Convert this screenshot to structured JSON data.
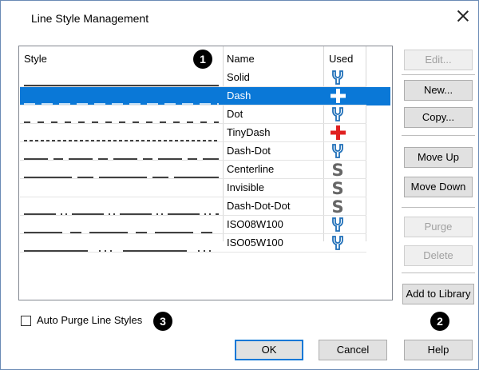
{
  "dialog": {
    "title": "Line Style Management",
    "close_icon": "close-icon"
  },
  "table": {
    "headers": {
      "style": "Style",
      "name": "Name",
      "used": "Used"
    },
    "rows": [
      {
        "name": "Solid",
        "used": "wrench",
        "selected": false
      },
      {
        "name": "Dash",
        "used": "plus-white",
        "selected": true
      },
      {
        "name": "Dot",
        "used": "wrench",
        "selected": false
      },
      {
        "name": "TinyDash",
        "used": "plus-red",
        "selected": false
      },
      {
        "name": "Dash-Dot",
        "used": "wrench",
        "selected": false
      },
      {
        "name": "Centerline",
        "used": "s",
        "selected": false
      },
      {
        "name": "Invisible",
        "used": "s",
        "selected": false
      },
      {
        "name": "Dash-Dot-Dot",
        "used": "s",
        "selected": false
      },
      {
        "name": "ISO08W100",
        "used": "wrench",
        "selected": false
      },
      {
        "name": "ISO05W100",
        "used": "wrench",
        "selected": false
      }
    ]
  },
  "buttons": {
    "edit": "Edit...",
    "new": "New...",
    "copy": "Copy...",
    "move_up": "Move Up",
    "move_down": "Move Down",
    "purge": "Purge",
    "delete": "Delete",
    "add_to_library": "Add to Library",
    "ok": "OK",
    "cancel": "Cancel",
    "help": "Help"
  },
  "checkbox": {
    "label": "Auto Purge Line Styles",
    "checked": false
  },
  "markers": {
    "m1": "1",
    "m2": "2",
    "m3": "3"
  },
  "colors": {
    "selection": "#0a78d7",
    "wrench": "#1f6fb8",
    "plus_red": "#e02020",
    "s_gray": "#666666"
  }
}
